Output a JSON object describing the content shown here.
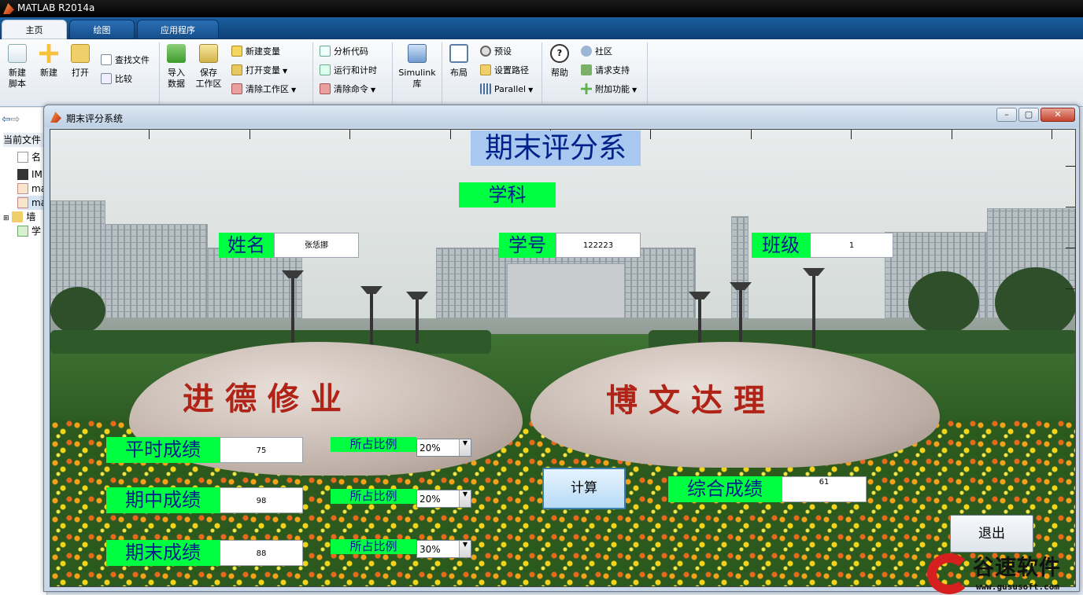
{
  "app": {
    "title": "MATLAB R2014a"
  },
  "tabs": [
    {
      "label": "主页",
      "active": true
    },
    {
      "label": "绘图",
      "active": false
    },
    {
      "label": "应用程序",
      "active": false
    }
  ],
  "ribbon": {
    "new_script": "新建\n脚本",
    "new": "新建",
    "open": "打开",
    "find_files": "查找文件",
    "compare": "比较",
    "import_data": "导入\n数据",
    "save_workspace": "保存\n工作区",
    "new_variable": "新建变量",
    "open_variable": "打开变量",
    "clear_workspace": "清除工作区",
    "analyze_code": "分析代码",
    "run_and_time": "运行和计时",
    "clear_commands": "清除命令",
    "simulink": "Simulink\n库",
    "layout": "布局",
    "preferences": "预设",
    "set_path": "设置路径",
    "parallel": "Parallel",
    "help": "帮助",
    "community": "社区",
    "request_support": "请求支持",
    "addons": "附加功能"
  },
  "left_panel": {
    "title": "当前文件",
    "column": "名",
    "rows": [
      "IM",
      "ma",
      "ma",
      "墙",
      "学"
    ]
  },
  "figure": {
    "title": "期末评分系统",
    "heading": "期末评分系",
    "subject_label": "学科",
    "name_label": "姓名",
    "name_value": "张恁挪",
    "id_label": "学号",
    "id_value": "122223",
    "class_label": "班级",
    "class_value": "1",
    "rows": [
      {
        "label": "平时成绩",
        "score": "75",
        "ratio_label": "所占比例",
        "ratio": "20%"
      },
      {
        "label": "期中成绩",
        "score": "98",
        "ratio_label": "所占比例",
        "ratio": "20%"
      },
      {
        "label": "期末成绩",
        "score": "88",
        "ratio_label": "所占比例",
        "ratio": "30%"
      }
    ],
    "calc_button": "计算",
    "total_label": "综合成绩",
    "total_value": "61",
    "exit_button": "退出",
    "rock_left_text": "进德修业",
    "rock_right_text": "博文达理"
  },
  "window_buttons": {
    "minimize": "–",
    "maximize": "▢",
    "close": "✕"
  },
  "watermark": {
    "brand": "谷速软件",
    "url": "www.gususoft.com"
  }
}
